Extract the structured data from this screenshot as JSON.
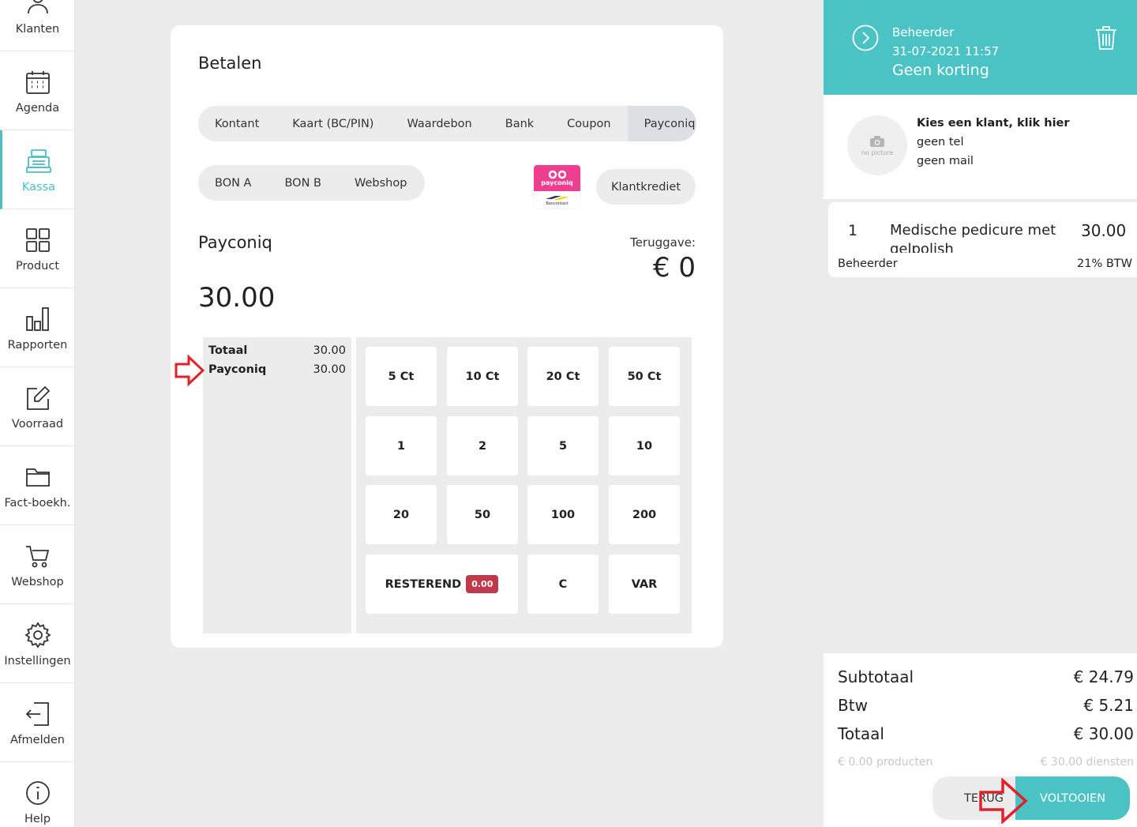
{
  "sidebar": {
    "items": [
      {
        "label": "Klanten",
        "icon": "users-icon"
      },
      {
        "label": "Agenda",
        "icon": "calendar-icon"
      },
      {
        "label": "Kassa",
        "icon": "cash-register-icon"
      },
      {
        "label": "Product",
        "icon": "grid-icon"
      },
      {
        "label": "Rapporten",
        "icon": "bar-chart-icon"
      },
      {
        "label": "Voorraad",
        "icon": "edit-icon"
      },
      {
        "label": "Fact-boekh.",
        "icon": "folder-icon"
      },
      {
        "label": "Webshop",
        "icon": "cart-icon"
      },
      {
        "label": "Instellingen",
        "icon": "gear-icon"
      },
      {
        "label": "Afmelden",
        "icon": "logout-icon"
      },
      {
        "label": "Help",
        "icon": "info-icon"
      }
    ],
    "active": "Kassa",
    "accent": "#4bbfc3"
  },
  "payment": {
    "title": "Betalen",
    "methods": [
      "Kontant",
      "Kaart (BC/PIN)",
      "Waardebon",
      "Bank",
      "Coupon",
      "Payconiq"
    ],
    "selected_method": "Payconiq",
    "extra_methods": [
      "BON A",
      "BON B",
      "Webshop"
    ],
    "logo_text": "payconiq",
    "logo_sub": "Bancontact",
    "klantkrediet": "Klantkrediet",
    "method_name": "Payconiq",
    "amount": "30.00",
    "teruggave_label": "Teruggave:",
    "teruggave_value": "€ 0",
    "summary": [
      {
        "label": "Totaal",
        "value": "30.00"
      },
      {
        "label": "Payconiq",
        "value": "30.00"
      }
    ],
    "keys": {
      "k5ct": "5 Ct",
      "k10ct": "10 Ct",
      "k20ct": "20 Ct",
      "k50ct": "50 Ct",
      "k1": "1",
      "k2": "2",
      "k5": "5",
      "k10": "10",
      "k20": "20",
      "k50": "50",
      "k100": "100",
      "k200": "200",
      "resterend": "RESTEREND",
      "resterend_badge": "0.00",
      "clear": "C",
      "var": "VAR"
    }
  },
  "header": {
    "user": "Beheerder",
    "datetime": "31-07-2021 11:57",
    "discount": "Geen korting",
    "color": "#4bc3c4"
  },
  "client": {
    "avatar_text": "no picture",
    "name": "Kies een klant, klik hier",
    "tel": "geen tel",
    "mail": "geen mail"
  },
  "lines": [
    {
      "qty": "1",
      "description": "Medische pedicure met gelpolish",
      "price": "30.00",
      "employee": "Beheerder",
      "vat": "21% BTW"
    }
  ],
  "totals": {
    "subtotal_label": "Subtotaal",
    "subtotal": "€ 24.79",
    "btw_label": "Btw",
    "btw": "€ 5.21",
    "total_label": "Totaal",
    "total": "€ 30.00",
    "products": "€ 0.00 producten",
    "services": "€ 30.00 diensten"
  },
  "actions": {
    "back": "TERUG",
    "complete": "VOLTOOIEN"
  }
}
